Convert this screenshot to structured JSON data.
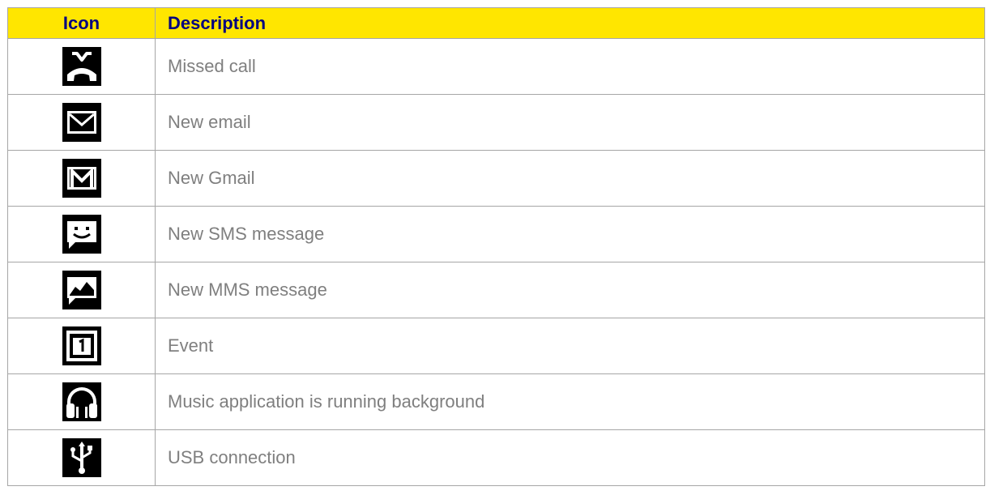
{
  "table": {
    "headers": {
      "icon": "Icon",
      "description": "Description"
    },
    "rows": [
      {
        "icon": "missed-call-icon",
        "description": "Missed call"
      },
      {
        "icon": "email-icon",
        "description": "New email"
      },
      {
        "icon": "gmail-icon",
        "description": "New Gmail"
      },
      {
        "icon": "sms-message-icon",
        "description": "New SMS message"
      },
      {
        "icon": "mms-message-icon",
        "description": "New MMS message"
      },
      {
        "icon": "calendar-event-icon",
        "description": "Event"
      },
      {
        "icon": "headphones-icon",
        "description": "Music application is running background"
      },
      {
        "icon": "usb-icon",
        "description": "USB connection"
      }
    ]
  },
  "colors": {
    "header_background": "#ffe600",
    "header_text": "#000080",
    "description_text": "#7f7f7f",
    "border": "#a6a6a6",
    "icon_background": "#000000"
  }
}
